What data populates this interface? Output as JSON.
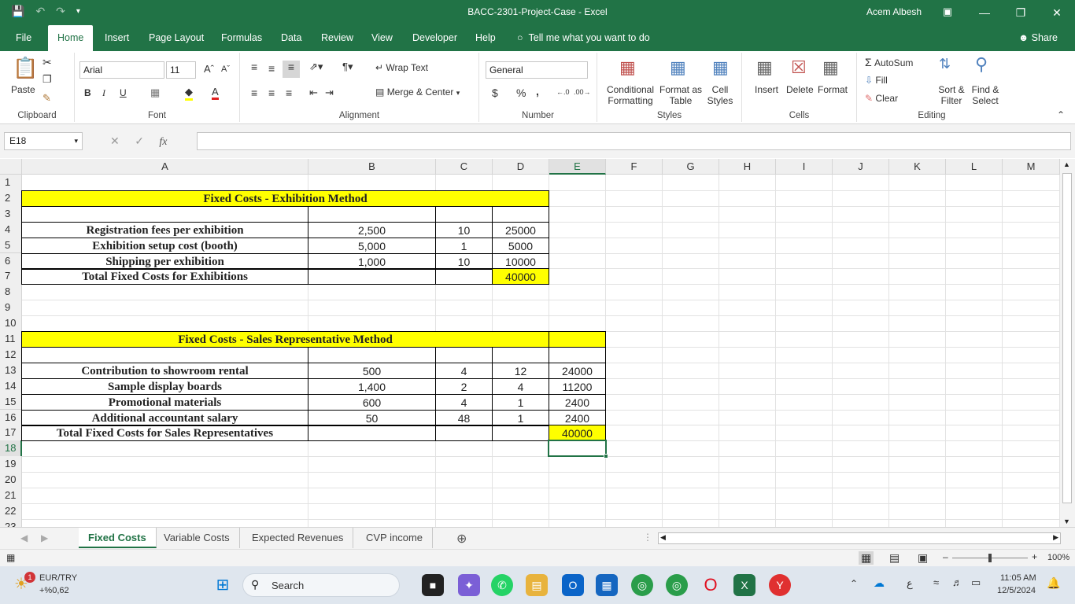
{
  "window": {
    "title": "BACC-2301-Project-Case  -  Excel",
    "user": "Acem Albesh"
  },
  "tabs": [
    "File",
    "Home",
    "Insert",
    "Page Layout",
    "Formulas",
    "Data",
    "Review",
    "View",
    "Developer",
    "Help"
  ],
  "tell_me": "Tell me what you want to do",
  "share": "Share",
  "ribbon": {
    "clipboard": {
      "label": "Clipboard",
      "paste": "Paste"
    },
    "font": {
      "label": "Font",
      "name": "Arial",
      "size": "11",
      "bold": "B",
      "italic": "I",
      "underline": "U"
    },
    "alignment": {
      "label": "Alignment",
      "wrap_text": "Wrap Text",
      "merge_center": "Merge & Center"
    },
    "number": {
      "label": "Number",
      "format": "General",
      "currency": "$",
      "percent": "%",
      "comma": ","
    },
    "styles": {
      "label": "Styles",
      "conditional_1": "Conditional",
      "conditional_2": "Formatting",
      "format_as_1": "Format as",
      "format_as_2": "Table",
      "cell_styles_1": "Cell",
      "cell_styles_2": "Styles"
    },
    "cells": {
      "label": "Cells",
      "insert": "Insert",
      "delete": "Delete",
      "format": "Format"
    },
    "editing": {
      "label": "Editing",
      "autosum": "AutoSum",
      "fill": "Fill",
      "clear": "Clear",
      "sort_1": "Sort &",
      "sort_2": "Filter",
      "find_1": "Find &",
      "find_2": "Select"
    }
  },
  "formula_bar": {
    "name_box": "E18",
    "fx": "fx",
    "value": ""
  },
  "columns": [
    "A",
    "B",
    "C",
    "D",
    "E",
    "F",
    "G",
    "H",
    "I",
    "J",
    "K",
    "L",
    "M"
  ],
  "rows": [
    "1",
    "2",
    "3",
    "4",
    "5",
    "6",
    "7",
    "8",
    "9",
    "10",
    "11",
    "12",
    "13",
    "14",
    "15",
    "16",
    "17",
    "18",
    "19",
    "20",
    "21",
    "22",
    "23"
  ],
  "sheet": {
    "exhibition_title": "Fixed Costs - Exhibition Method",
    "exhibition_rows": [
      {
        "label": "Registration fees per exhibition",
        "b": "2,500",
        "c": "10",
        "d": "25000"
      },
      {
        "label": "Exhibition setup cost (booth)",
        "b": "5,000",
        "c": "1",
        "d": "5000"
      },
      {
        "label": "Shipping per exhibition",
        "b": "1,000",
        "c": "10",
        "d": "10000"
      }
    ],
    "exhibition_total_label": "Total Fixed Costs for Exhibitions",
    "exhibition_total": "40000",
    "sales_title": "Fixed Costs - Sales Representative Method",
    "sales_rows": [
      {
        "label": "Contribution to showroom rental",
        "b": "500",
        "c": "4",
        "d": "12",
        "e": "24000"
      },
      {
        "label": "Sample display boards",
        "b": "1,400",
        "c": "2",
        "d": "4",
        "e": "11200"
      },
      {
        "label": "Promotional materials",
        "b": "600",
        "c": "4",
        "d": "1",
        "e": "2400"
      },
      {
        "label": "Additional accountant salary",
        "b": "50",
        "c": "48",
        "d": "1",
        "e": "2400"
      }
    ],
    "sales_total_label": "Total Fixed Costs for Sales Representatives",
    "sales_total": "40000"
  },
  "sheet_tabs": [
    "Fixed Costs",
    "Variable Costs",
    "Expected Revenues",
    "CVP income"
  ],
  "status": {
    "zoom": "100%"
  },
  "taskbar": {
    "ticker": "EUR/TRY",
    "ticker_change": "+%0,62",
    "ticker_badge": "1",
    "search": "Search",
    "time": "11:05 AM",
    "date": "12/5/2024",
    "lang": "ع"
  },
  "colors": {
    "excel_green": "#217346",
    "highlight": "#ffff00"
  }
}
